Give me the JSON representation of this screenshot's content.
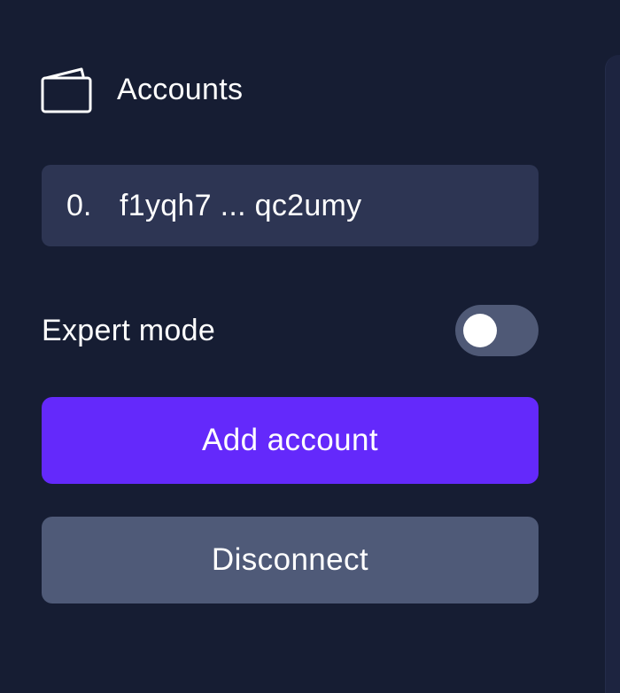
{
  "header": {
    "icon": "wallet-icon",
    "title": "Accounts"
  },
  "accounts": [
    {
      "index": "0.",
      "address": "f1yqh7 ... qc2umy"
    }
  ],
  "expert_mode": {
    "label": "Expert mode",
    "enabled": false
  },
  "buttons": {
    "add_account": "Add account",
    "disconnect": "Disconnect"
  },
  "colors": {
    "background": "#161d33",
    "card": "#2d3553",
    "accent": "#6429fb",
    "secondary_button": "#4f5a78",
    "toggle_track_off": "#4f5976"
  }
}
